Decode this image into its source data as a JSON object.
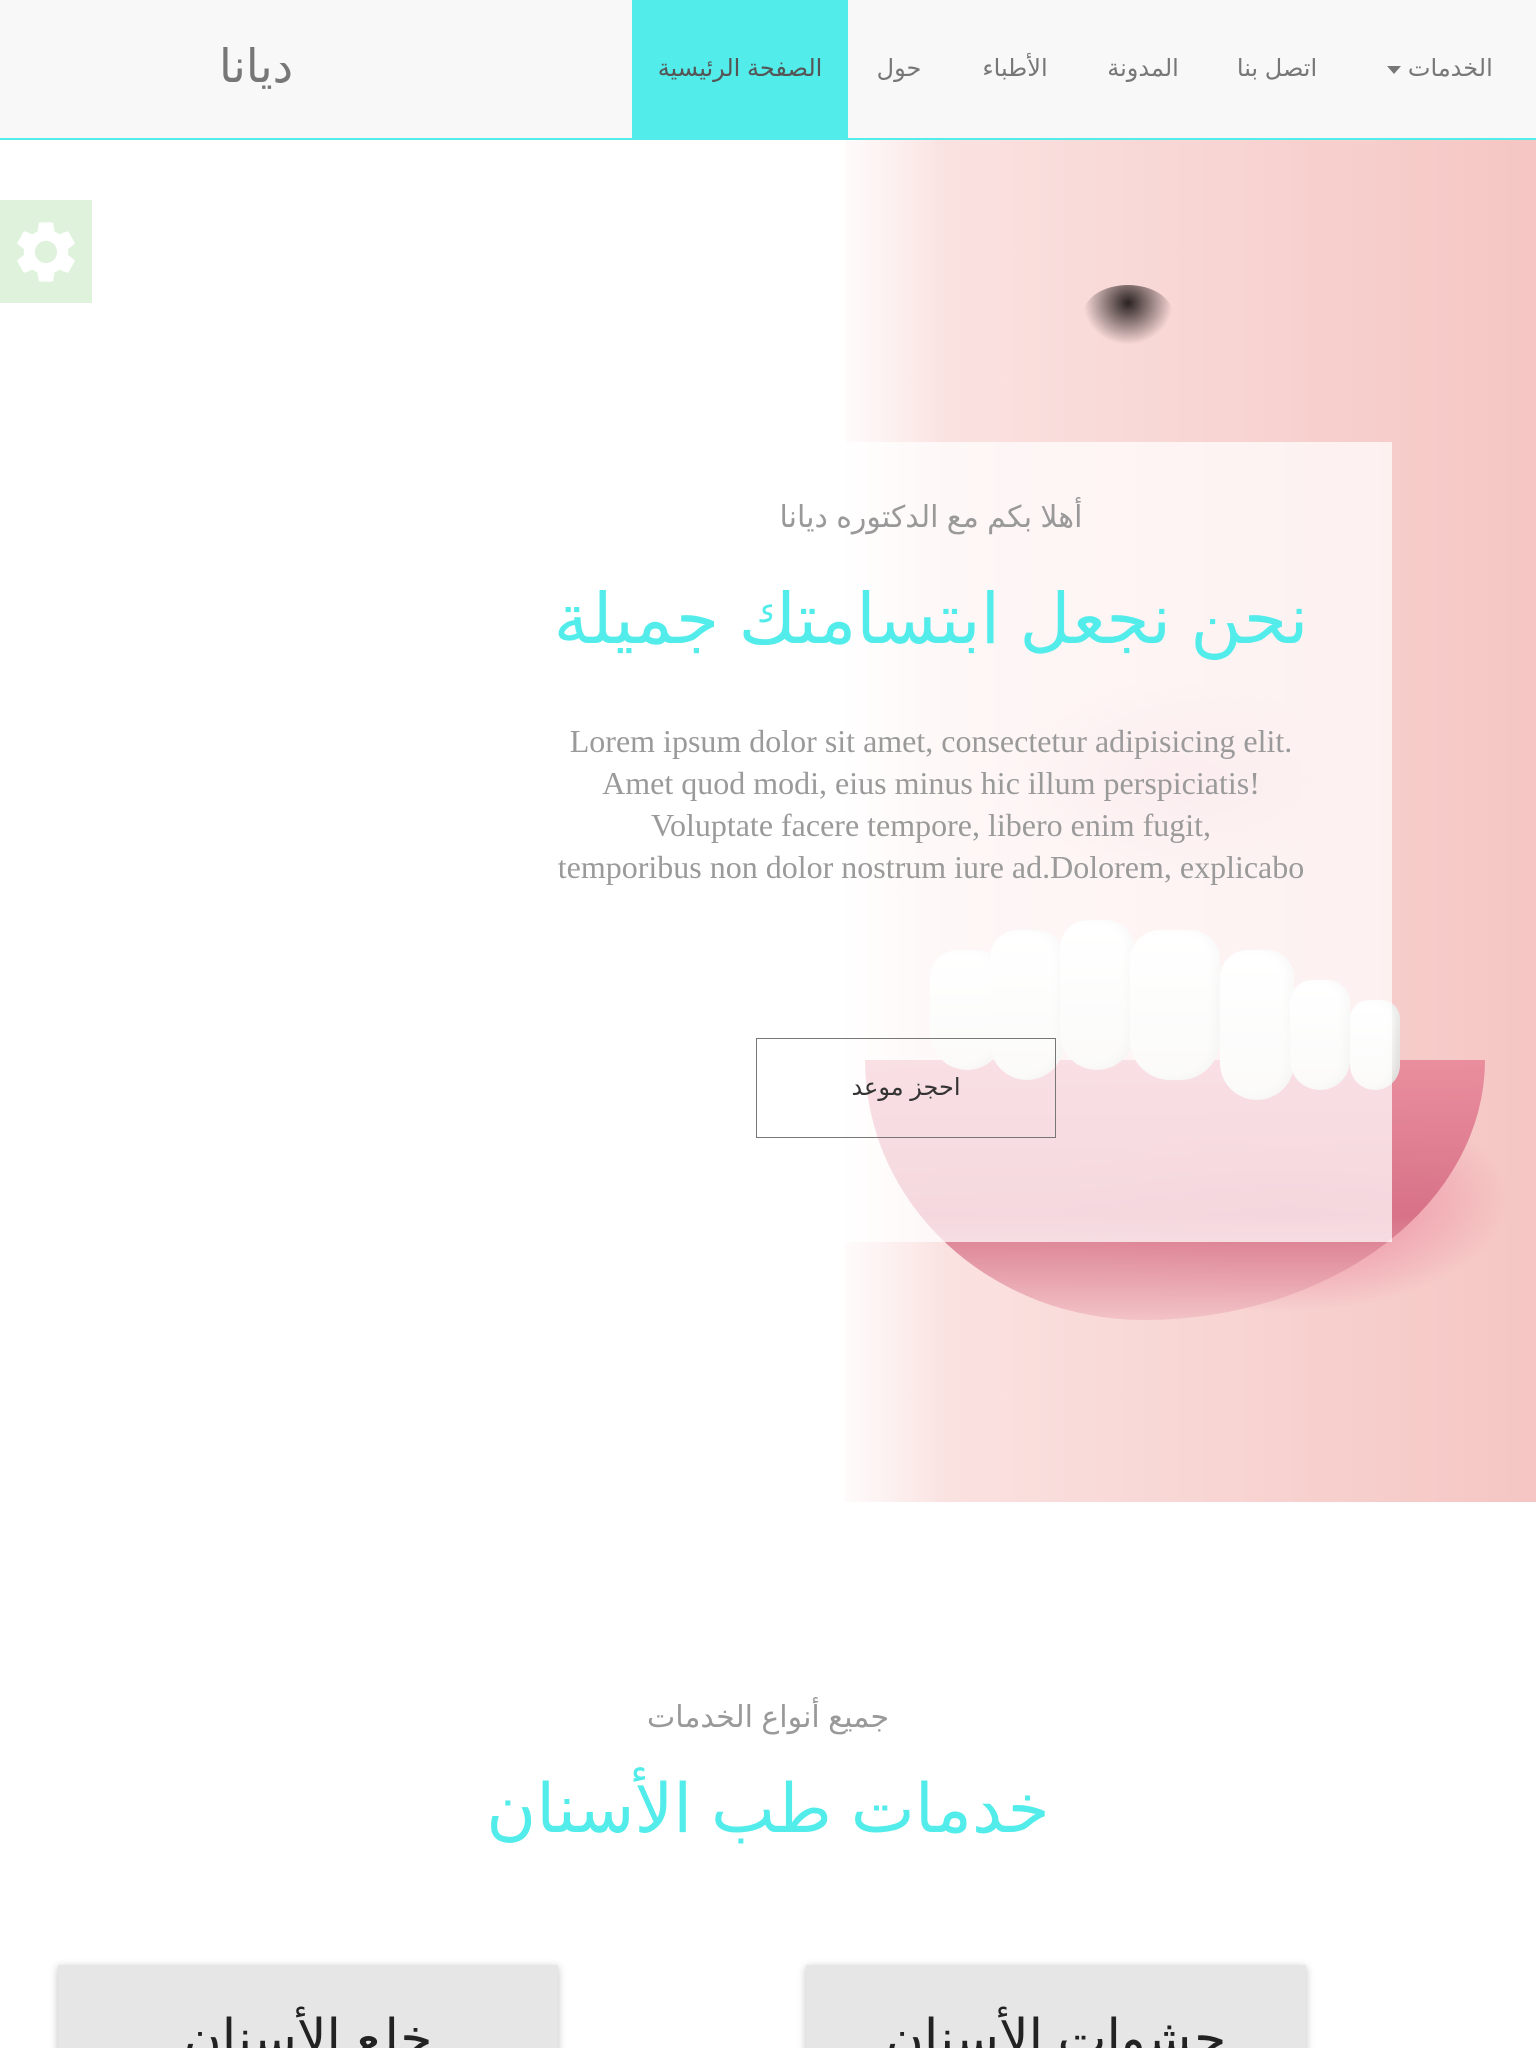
{
  "nav": {
    "brand": "ديانا",
    "home": "الصفحة الرئيسية",
    "about": "حول",
    "doctors": "الأطباء",
    "blog": "المدونة",
    "contact": "اتصل بنا",
    "services": "الخدمات"
  },
  "colors": {
    "accent": "#52ecea",
    "settings_bg": "#dff2dc",
    "nav_bg": "#f8f8f8"
  },
  "settings": {
    "icon": "gear-icon"
  },
  "hero": {
    "welcome": "أهلا بكم مع الدكتوره ديانا",
    "title": "نحن نجعل ابتسامتك جميلة",
    "lines": [
      "Lorem ipsum dolor sit amet, consectetur adipisicing elit.",
      "Amet quod modi, eius minus hic illum perspiciatis!",
      "Voluptate facere tempore, libero enim fugit,",
      "temporibus non dolor nostrum iure ad.Dolorem, explicabo"
    ],
    "button": "احجز موعد"
  },
  "services": {
    "subtitle": "جميع أنواع الخدمات",
    "title": "خدمات طب الأسنان",
    "cards": [
      {
        "title": "حشوات الأسنان"
      },
      {
        "title": "خلع الأسنان"
      }
    ]
  }
}
